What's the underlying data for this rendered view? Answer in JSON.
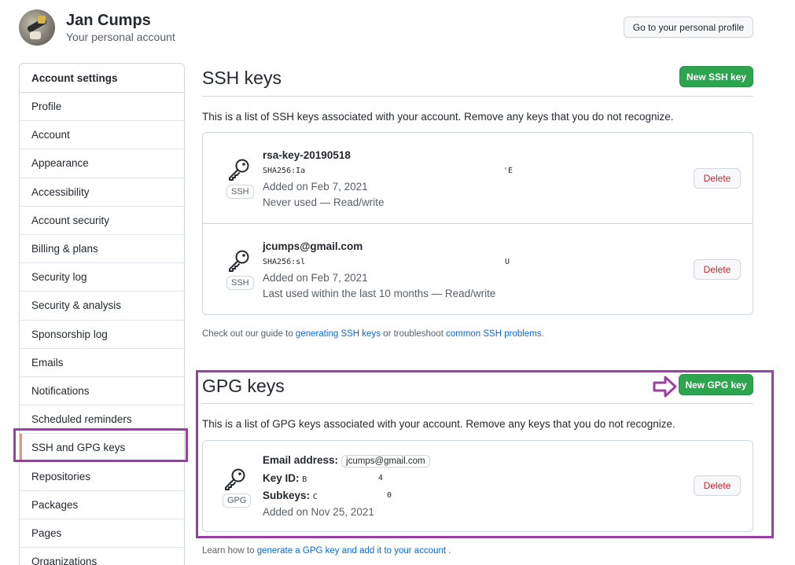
{
  "header": {
    "user_name": "Jan Cumps",
    "user_subtitle": "Your personal account",
    "profile_button": "Go to your personal profile"
  },
  "sidebar": {
    "heading": "Account settings",
    "items": [
      {
        "label": "Profile"
      },
      {
        "label": "Account"
      },
      {
        "label": "Appearance"
      },
      {
        "label": "Accessibility"
      },
      {
        "label": "Account security"
      },
      {
        "label": "Billing & plans"
      },
      {
        "label": "Security log"
      },
      {
        "label": "Security & analysis"
      },
      {
        "label": "Sponsorship log"
      },
      {
        "label": "Emails"
      },
      {
        "label": "Notifications"
      },
      {
        "label": "Scheduled reminders"
      },
      {
        "label": "SSH and GPG keys",
        "selected": true
      },
      {
        "label": "Repositories"
      },
      {
        "label": "Packages"
      },
      {
        "label": "Pages"
      },
      {
        "label": "Organizations"
      }
    ]
  },
  "ssh": {
    "title": "SSH keys",
    "new_button": "New SSH key",
    "description": "This is a list of SSH keys associated with your account. Remove any keys that you do not recognize.",
    "keys": [
      {
        "title": "rsa-key-20190518",
        "badge": "SSH",
        "fingerprint_start": "SHA256:Ia",
        "fingerprint_end": "'E",
        "added": "Added on Feb 7, 2021",
        "usage": "Never used — Read/write",
        "delete": "Delete"
      },
      {
        "title": "jcumps@gmail.com",
        "badge": "SSH",
        "fingerprint_start": "SHA256:sl",
        "fingerprint_end": "U",
        "added": "Added on Feb 7, 2021",
        "usage": "Last used within the last 10 months — Read/write",
        "delete": "Delete"
      }
    ],
    "help_prefix": "Check out our guide to",
    "help_link1": "generating SSH keys",
    "help_middle": "or troubleshoot",
    "help_link2": "common SSH problems",
    "help_suffix": "."
  },
  "gpg": {
    "title": "GPG keys",
    "new_button": "New GPG key",
    "description": "This is a list of GPG keys associated with your account. Remove any keys that you do not recognize.",
    "key": {
      "badge": "GPG",
      "email_label": "Email address:",
      "email_value": "jcumps@gmail.com",
      "keyid_label": "Key ID:",
      "keyid_start": "B",
      "keyid_end": "4",
      "subkeys_label": "Subkeys:",
      "subkeys_start": "C",
      "subkeys_end": "0",
      "added": "Added on Nov 25, 2021",
      "delete": "Delete"
    },
    "help_prefix": "Learn how to",
    "help_link": "generate a GPG key and add it to your account",
    "help_suffix": "."
  },
  "colors": {
    "accent_green": "#2da44e",
    "danger": "#cf222e",
    "link": "#0969da",
    "annotation_purple": "#9a3fa6"
  }
}
